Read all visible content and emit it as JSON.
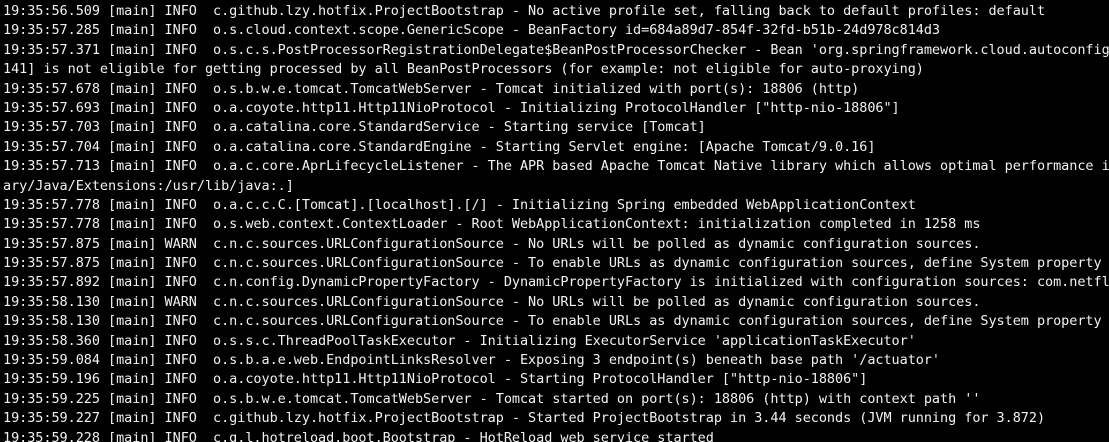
{
  "colors": {
    "background": "#000000",
    "text": "#f2f2f2"
  },
  "log_lines": [
    "19:35:56.509 [main] INFO  c.github.lzy.hotfix.ProjectBootstrap - No active profile set, falling back to default profiles: default",
    "19:35:57.285 [main] INFO  o.s.cloud.context.scope.GenericScope - BeanFactory id=684a89d7-854f-32fd-b51b-24d978c814d3",
    "19:35:57.371 [main] INFO  o.s.c.s.PostProcessorRegistrationDelegate$BeanPostProcessorChecker - Bean 'org.springframework.cloud.autoconfigu",
    "141] is not eligible for getting processed by all BeanPostProcessors (for example: not eligible for auto-proxying)",
    "19:35:57.678 [main] INFO  o.s.b.w.e.tomcat.TomcatWebServer - Tomcat initialized with port(s): 18806 (http)",
    "19:35:57.693 [main] INFO  o.a.coyote.http11.Http11NioProtocol - Initializing ProtocolHandler [\"http-nio-18806\"]",
    "19:35:57.703 [main] INFO  o.a.catalina.core.StandardService - Starting service [Tomcat]",
    "19:35:57.704 [main] INFO  o.a.catalina.core.StandardEngine - Starting Servlet engine: [Apache Tomcat/9.0.16]",
    "19:35:57.713 [main] INFO  o.a.c.core.AprLifecycleListener - The APR based Apache Tomcat Native library which allows optimal performance in",
    "ary/Java/Extensions:/usr/lib/java:.]",
    "19:35:57.778 [main] INFO  o.a.c.c.C.[Tomcat].[localhost].[/] - Initializing Spring embedded WebApplicationContext",
    "19:35:57.778 [main] INFO  o.s.web.context.ContextLoader - Root WebApplicationContext: initialization completed in 1258 ms",
    "19:35:57.875 [main] WARN  c.n.c.sources.URLConfigurationSource - No URLs will be polled as dynamic configuration sources.",
    "19:35:57.875 [main] INFO  c.n.c.sources.URLConfigurationSource - To enable URLs as dynamic configuration sources, define System property a",
    "19:35:57.892 [main] INFO  c.n.config.DynamicPropertyFactory - DynamicPropertyFactory is initialized with configuration sources: com.netfli",
    "19:35:58.130 [main] WARN  c.n.c.sources.URLConfigurationSource - No URLs will be polled as dynamic configuration sources.",
    "19:35:58.130 [main] INFO  c.n.c.sources.URLConfigurationSource - To enable URLs as dynamic configuration sources, define System property a",
    "19:35:58.360 [main] INFO  o.s.s.c.ThreadPoolTaskExecutor - Initializing ExecutorService 'applicationTaskExecutor'",
    "19:35:59.084 [main] INFO  o.s.b.a.e.web.EndpointLinksResolver - Exposing 3 endpoint(s) beneath base path '/actuator'",
    "19:35:59.196 [main] INFO  o.a.coyote.http11.Http11NioProtocol - Starting ProtocolHandler [\"http-nio-18806\"]",
    "19:35:59.225 [main] INFO  o.s.b.w.e.tomcat.TomcatWebServer - Tomcat started on port(s): 18806 (http) with context path ''",
    "19:35:59.227 [main] INFO  c.github.lzy.hotfix.ProjectBootstrap - Started ProjectBootstrap in 3.44 seconds (JVM running for 3.872)",
    "19:35:59.228 [main] INFO  c.g.l.hotreload.boot.Bootstrap - HotReload web service started"
  ]
}
